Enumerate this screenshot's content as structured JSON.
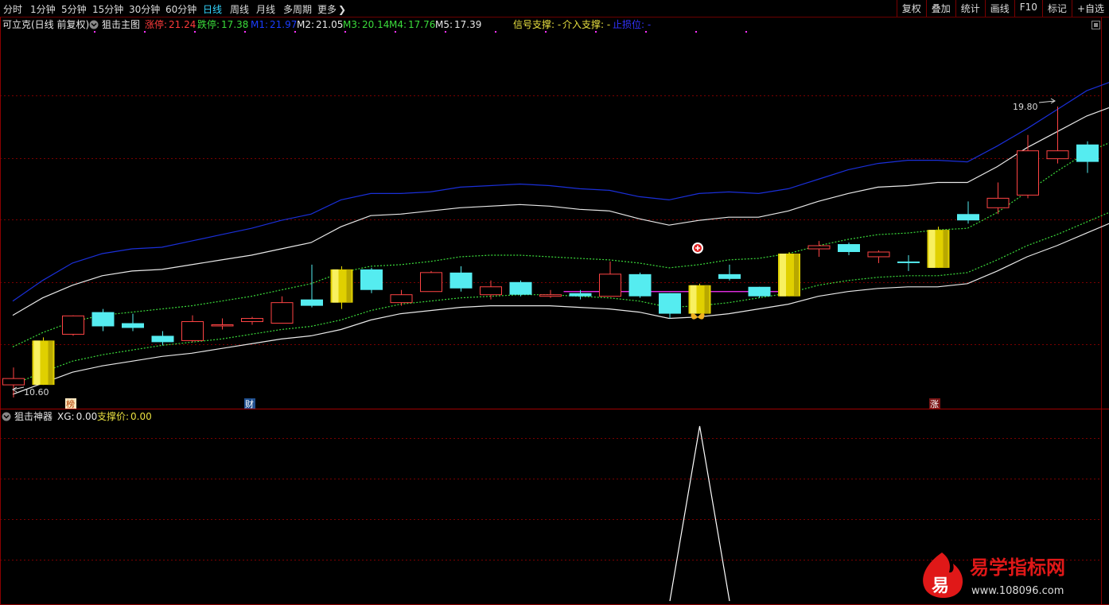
{
  "toolbar": {
    "timeframes": [
      {
        "label": "分时",
        "active": false
      },
      {
        "label": "1分钟",
        "active": false
      },
      {
        "label": "5分钟",
        "active": false
      },
      {
        "label": "15分钟",
        "active": false
      },
      {
        "label": "30分钟",
        "active": false
      },
      {
        "label": "60分钟",
        "active": false
      },
      {
        "label": "日线",
        "active": true
      },
      {
        "label": "周线",
        "active": false
      },
      {
        "label": "月线",
        "active": false
      },
      {
        "label": "多周期",
        "active": false
      },
      {
        "label": "更多",
        "active": false
      }
    ],
    "right_buttons": [
      "复权",
      "叠加",
      "统计",
      "画线",
      "F10",
      "标记",
      "+自选"
    ]
  },
  "main": {
    "stock_title": "可立克(日线 前复权)",
    "indicator_name": "狙击主图",
    "legend": [
      {
        "label": "涨停:",
        "value": "21.24",
        "color": "#ff3b3b"
      },
      {
        "label": "跌停:",
        "value": "17.38",
        "color": "#3bdc3b"
      },
      {
        "label": "M1:",
        "value": "21.97",
        "color": "#1a3dff"
      },
      {
        "label": "M2:",
        "value": "21.05",
        "color": "#e8e8e8"
      },
      {
        "label": "M3:",
        "value": "20.14",
        "color": "#3bdc3b"
      },
      {
        "label": "M4:",
        "value": "17.76",
        "color": "#3bdc3b"
      },
      {
        "label": "M5:",
        "value": "17.39",
        "color": "#e8e8e8"
      }
    ],
    "signal_legend": [
      {
        "text": "信号支撑: -",
        "color": "#e8e040"
      },
      {
        "text": "介入支撑: -",
        "color": "#e8e040"
      },
      {
        "text": "止损位: -",
        "color": "#3333ff"
      }
    ],
    "price_high_label": "19.80",
    "price_low_label": "10.60",
    "event_tags": [
      "榜",
      "财",
      "涨"
    ]
  },
  "sub": {
    "indicator_name": "狙击神器",
    "legend": [
      {
        "label": "XG:",
        "value": "0.00",
        "color": "#e8e8e8"
      },
      {
        "label": "支撑价:",
        "value": "0.00",
        "color": "#e8e040"
      }
    ]
  },
  "watermark": {
    "logo_char": "易",
    "title": "易学指标网",
    "url": "www.108096.com"
  },
  "chart_data": {
    "type": "candlestick",
    "candles": [
      {
        "o": 11.0,
        "h": 11.55,
        "l": 10.6,
        "c": 11.2
      },
      {
        "o": 11.0,
        "h": 12.5,
        "l": 11.0,
        "c": 12.4
      },
      {
        "o": 12.6,
        "h": 13.2,
        "l": 12.55,
        "c": 13.18
      },
      {
        "o": 13.3,
        "h": 13.4,
        "l": 12.7,
        "c": 12.85
      },
      {
        "o": 12.95,
        "h": 13.25,
        "l": 12.7,
        "c": 12.8
      },
      {
        "o": 12.55,
        "h": 12.7,
        "l": 12.25,
        "c": 12.35
      },
      {
        "o": 12.4,
        "h": 13.2,
        "l": 12.35,
        "c": 13.0
      },
      {
        "o": 12.9,
        "h": 13.1,
        "l": 12.75,
        "c": 12.9
      },
      {
        "o": 13.0,
        "h": 13.15,
        "l": 12.9,
        "c": 13.1
      },
      {
        "o": 12.95,
        "h": 13.8,
        "l": 12.95,
        "c": 13.6
      },
      {
        "o": 13.7,
        "h": 14.8,
        "l": 13.45,
        "c": 13.5
      },
      {
        "o": 13.6,
        "h": 14.75,
        "l": 13.4,
        "c": 14.65
      },
      {
        "o": 14.65,
        "h": 14.7,
        "l": 13.9,
        "c": 14.0
      },
      {
        "o": 13.6,
        "h": 14.0,
        "l": 13.5,
        "c": 13.85
      },
      {
        "o": 13.95,
        "h": 14.6,
        "l": 13.95,
        "c": 14.55
      },
      {
        "o": 14.55,
        "h": 14.75,
        "l": 13.95,
        "c": 14.05
      },
      {
        "o": 13.85,
        "h": 14.3,
        "l": 13.7,
        "c": 14.1
      },
      {
        "o": 14.25,
        "h": 14.3,
        "l": 13.8,
        "c": 13.85
      },
      {
        "o": 13.8,
        "h": 14.0,
        "l": 13.75,
        "c": 13.85
      },
      {
        "o": 13.9,
        "h": 14.0,
        "l": 13.7,
        "c": 13.8
      },
      {
        "o": 13.8,
        "h": 14.9,
        "l": 13.8,
        "c": 14.5
      },
      {
        "o": 14.5,
        "h": 14.55,
        "l": 13.75,
        "c": 13.8
      },
      {
        "o": 13.9,
        "h": 13.9,
        "l": 13.1,
        "c": 13.25
      },
      {
        "o": 13.25,
        "h": 14.2,
        "l": 13.25,
        "c": 14.15
      },
      {
        "o": 14.5,
        "h": 14.8,
        "l": 14.3,
        "c": 14.35
      },
      {
        "o": 14.1,
        "h": 14.1,
        "l": 13.75,
        "c": 13.8
      },
      {
        "o": 13.8,
        "h": 15.2,
        "l": 13.8,
        "c": 15.15
      },
      {
        "o": 15.3,
        "h": 15.55,
        "l": 15.05,
        "c": 15.4
      },
      {
        "o": 15.45,
        "h": 15.5,
        "l": 15.1,
        "c": 15.2
      },
      {
        "o": 15.05,
        "h": 15.25,
        "l": 14.85,
        "c": 15.2
      },
      {
        "o": 14.9,
        "h": 15.1,
        "l": 14.6,
        "c": 14.85
      },
      {
        "o": 14.7,
        "h": 16.0,
        "l": 14.7,
        "c": 15.9
      },
      {
        "o": 16.4,
        "h": 16.8,
        "l": 16.1,
        "c": 16.2
      },
      {
        "o": 16.6,
        "h": 17.4,
        "l": 16.4,
        "c": 16.9
      },
      {
        "o": 17.0,
        "h": 18.9,
        "l": 16.9,
        "c": 18.4
      },
      {
        "o": 18.15,
        "h": 19.8,
        "l": 18.0,
        "c": 18.4
      },
      {
        "o": 18.6,
        "h": 18.7,
        "l": 17.7,
        "c": 18.05
      }
    ],
    "yellow_bars": [
      1,
      11,
      23,
      26,
      31
    ],
    "channel_M1": [
      13.65,
      14.3,
      14.85,
      15.15,
      15.3,
      15.35,
      15.55,
      15.75,
      15.95,
      16.2,
      16.4,
      16.85,
      17.05,
      17.05,
      17.1,
      17.25,
      17.3,
      17.35,
      17.3,
      17.2,
      17.15,
      16.95,
      16.85,
      17.05,
      17.1,
      17.05,
      17.2,
      17.5,
      17.8,
      18.0,
      18.1,
      18.1,
      18.05,
      18.55,
      19.1,
      19.7,
      20.3,
      20.65,
      20.85
    ],
    "channel_M2": [
      13.2,
      13.75,
      14.15,
      14.45,
      14.6,
      14.65,
      14.8,
      14.95,
      15.1,
      15.3,
      15.5,
      16.0,
      16.35,
      16.4,
      16.5,
      16.6,
      16.65,
      16.7,
      16.65,
      16.55,
      16.5,
      16.25,
      16.05,
      16.2,
      16.3,
      16.3,
      16.5,
      16.8,
      17.05,
      17.25,
      17.3,
      17.4,
      17.4,
      17.9,
      18.5,
      19.0,
      19.5,
      19.85,
      20.05
    ],
    "channel_M3": [
      12.2,
      12.65,
      13.0,
      13.2,
      13.3,
      13.4,
      13.5,
      13.65,
      13.8,
      14.0,
      14.2,
      14.55,
      14.75,
      14.8,
      14.9,
      15.05,
      15.1,
      15.1,
      15.05,
      15.0,
      14.95,
      14.85,
      14.7,
      14.8,
      14.95,
      15.0,
      15.15,
      15.4,
      15.6,
      15.75,
      15.8,
      15.9,
      15.95,
      16.45,
      17.1,
      17.75,
      18.35,
      18.75,
      19.0
    ],
    "channel_M4": [
      11.0,
      11.4,
      11.75,
      11.95,
      12.1,
      12.25,
      12.35,
      12.45,
      12.6,
      12.75,
      12.85,
      13.05,
      13.35,
      13.55,
      13.65,
      13.75,
      13.8,
      13.85,
      13.85,
      13.8,
      13.75,
      13.65,
      13.45,
      13.5,
      13.6,
      13.75,
      13.9,
      14.15,
      14.3,
      14.4,
      14.45,
      14.45,
      14.55,
      14.95,
      15.4,
      15.75,
      16.15,
      16.55,
      16.7
    ],
    "channel_M5": [
      10.7,
      11.05,
      11.4,
      11.6,
      11.75,
      11.9,
      12.0,
      12.15,
      12.3,
      12.45,
      12.55,
      12.75,
      13.05,
      13.25,
      13.35,
      13.45,
      13.5,
      13.5,
      13.5,
      13.45,
      13.4,
      13.3,
      13.1,
      13.15,
      13.25,
      13.4,
      13.55,
      13.8,
      13.95,
      14.05,
      14.1,
      14.1,
      14.2,
      14.6,
      15.05,
      15.4,
      15.8,
      16.2,
      16.35
    ],
    "support_line": {
      "value": 13.95,
      "from_index": 19,
      "to_index": 26
    },
    "signal_bar_index": 23,
    "sub_xg": [
      0,
      0,
      0,
      0,
      0,
      0,
      0,
      0,
      0,
      0,
      0,
      0,
      0,
      0,
      0,
      0,
      0,
      0,
      0,
      0,
      0,
      0,
      0,
      1,
      0,
      0,
      0,
      0,
      0,
      0,
      0,
      0,
      0,
      0,
      0,
      0,
      0
    ],
    "ylim": [
      10.4,
      21.4
    ]
  }
}
